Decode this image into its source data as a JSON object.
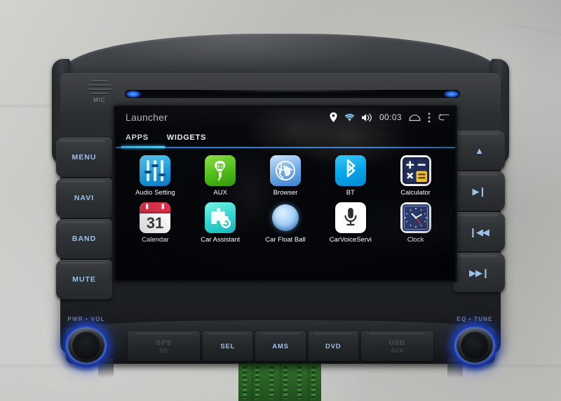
{
  "device": {
    "mic_label": "MIC",
    "knob_left_label": "PWR • VOL",
    "knob_right_label": "EQ • TUNE"
  },
  "buttons_left": [
    {
      "label": "MENU",
      "name": "menu-button"
    },
    {
      "label": "NAVI",
      "name": "navi-button"
    },
    {
      "label": "BAND",
      "name": "band-button"
    },
    {
      "label": "MUTE",
      "name": "mute-button"
    }
  ],
  "buttons_right": [
    {
      "glyph": "▲",
      "name": "eject-button"
    },
    {
      "glyph": "▶❙",
      "name": "play-pause-button"
    },
    {
      "glyph": "❙◀◀",
      "name": "previous-track-button"
    },
    {
      "glyph": "▶▶❙",
      "name": "next-track-button"
    }
  ],
  "buttons_bottom": [
    {
      "label": "GPS",
      "sub": "SD",
      "name": "gps-sd-slot",
      "dim": true,
      "wide": true
    },
    {
      "label": "SEL",
      "sub": "",
      "name": "sel-button",
      "dim": false,
      "wide": false
    },
    {
      "label": "AMS",
      "sub": "",
      "name": "ams-button",
      "dim": false,
      "wide": false
    },
    {
      "label": "DVD",
      "sub": "",
      "name": "dvd-button",
      "dim": false,
      "wide": false
    },
    {
      "label": "USB",
      "sub": "AUX",
      "name": "usb-aux-slot",
      "dim": true,
      "wide": true
    }
  ],
  "screen": {
    "title": "Launcher",
    "status": {
      "clock": "00:03",
      "icons": [
        "location-pin-icon",
        "wifi-icon",
        "volume-icon",
        "home-icon",
        "overflow-menu-icon",
        "back-icon"
      ]
    },
    "tabs": [
      {
        "label": "APPS",
        "active": true
      },
      {
        "label": "WIDGETS",
        "active": false
      }
    ],
    "apps": [
      {
        "label": "Audio Setting",
        "icon": "audio-setting-icon",
        "cls": "ic-audio"
      },
      {
        "label": "AUX",
        "icon": "aux-icon",
        "cls": "ic-aux"
      },
      {
        "label": "Browser",
        "icon": "browser-icon",
        "cls": "ic-browser"
      },
      {
        "label": "BT",
        "icon": "bluetooth-icon",
        "cls": "ic-bt"
      },
      {
        "label": "Calculator",
        "icon": "calculator-icon",
        "cls": "ic-calc"
      },
      {
        "label": "Calendar",
        "icon": "calendar-icon",
        "cls": "ic-cal"
      },
      {
        "label": "Car Assistant",
        "icon": "car-assistant-icon",
        "cls": "ic-carassist"
      },
      {
        "label": "Car Float Ball",
        "icon": "car-float-ball-icon",
        "cls": "ic-ball"
      },
      {
        "label": "CarVoiceServi",
        "icon": "car-voice-service-icon",
        "cls": "ic-voice"
      },
      {
        "label": "Clock",
        "icon": "clock-icon",
        "cls": "ic-clock"
      }
    ],
    "calendar_day": "31"
  },
  "colors": {
    "accent_blue": "#4fd2ff",
    "tab_underline": "#1d7fd6",
    "button_text": "#9dc0e8",
    "knob_glow": "#2a5aff"
  }
}
